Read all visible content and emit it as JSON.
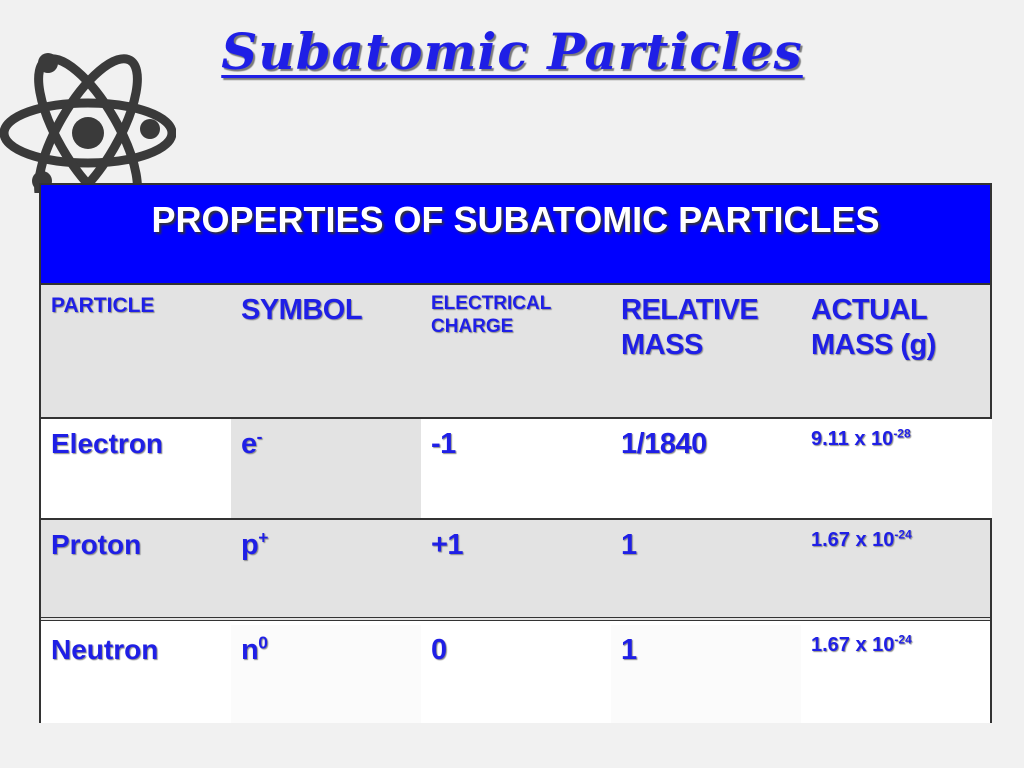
{
  "title": "Subatomic Particles",
  "table": {
    "banner": "PROPERTIES OF SUBATOMIC PARTICLES",
    "headers": {
      "particle": "PARTICLE",
      "symbol": "SYMBOL",
      "charge": "ELECTRICAL CHARGE",
      "relative_mass": "RELATIVE MASS",
      "actual_mass": "ACTUAL MASS (g)"
    },
    "rows": [
      {
        "particle": "Electron",
        "symbol": "e",
        "symbol_sup": "-",
        "charge": "-1",
        "relative_mass": "1/1840",
        "mass_base": "9.11 x 10",
        "mass_exp": "-28"
      },
      {
        "particle": "Proton",
        "symbol": "p",
        "symbol_sup": "+",
        "charge": "+1",
        "relative_mass": "1",
        "mass_base": "1.67 x 10",
        "mass_exp": "-24"
      },
      {
        "particle": "Neutron",
        "symbol": "n",
        "symbol_sup": "0",
        "charge": "0",
        "relative_mass": "1",
        "mass_base": "1.67 x 10",
        "mass_exp": "-24"
      }
    ]
  },
  "colors": {
    "accent_blue": "#0000ff",
    "text_blue": "#1f1fe6",
    "row_gray": "#e3e3e3"
  },
  "icons": {
    "logo": "atom-icon"
  }
}
